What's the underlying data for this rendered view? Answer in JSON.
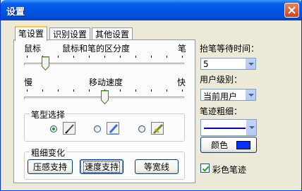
{
  "window": {
    "title": "设置"
  },
  "tabs": [
    {
      "label": "笔设置"
    },
    {
      "label": "识别设置"
    },
    {
      "label": "其他设置"
    }
  ],
  "resolution_slider": {
    "left_label": "鼠标",
    "center_label": "鼠标和笔的区分度",
    "right_label": "笔",
    "level": 0.12
  },
  "speed_slider": {
    "left_label": "慢",
    "center_label": "移动速度",
    "right_label": "快",
    "level": 0.5
  },
  "pen_type": {
    "legend": "笔型选择",
    "selected_index": 0,
    "options": [
      {
        "icon": "pen-icon"
      },
      {
        "icon": "marker-icon"
      },
      {
        "icon": "brush-icon"
      }
    ]
  },
  "thickness_change": {
    "legend": "粗细变化",
    "buttons": [
      {
        "label": "压感支持"
      },
      {
        "label": "速度支持"
      },
      {
        "label": "等宽线"
      }
    ],
    "focused_index": 1
  },
  "right_panel": {
    "lift_wait_label": "抬笔等待时间：",
    "lift_wait_value": "5",
    "user_level_label": "用户级别：",
    "user_level_value": "当前用户",
    "stroke_width_label": "笔迹粗细：",
    "color_button_label": "颜色",
    "color_value": "#0033ff",
    "color_stroke_label": "彩色笔迹",
    "color_stroke_checked": true
  },
  "colors": {
    "title_bar": "#0054e3",
    "close_button": "#c8451d",
    "stroke_line": "#0000cc"
  }
}
